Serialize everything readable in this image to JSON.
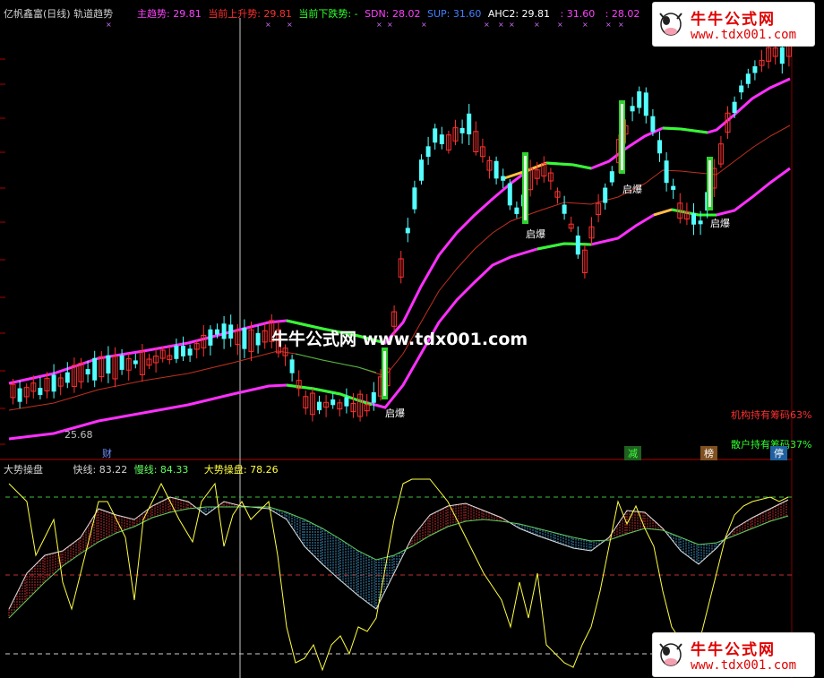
{
  "header": {
    "title": "亿帆鑫富(日线) 轨道趋势",
    "items": [
      {
        "label": "主趋势",
        "value": ": 29.81",
        "color": "#ff40ff"
      },
      {
        "label": "当前上升势",
        "value": ": 29.81",
        "color": "#ff3030"
      },
      {
        "label": "当前下跌势",
        "value": ": -",
        "color": "#30ff30"
      },
      {
        "label": "SDN",
        "value": ": 28.02",
        "color": "#ff40ff"
      },
      {
        "label": "SUP",
        "value": ": 31.60",
        "color": "#4080ff"
      },
      {
        "label": "AHC2",
        "value": ": 29.81",
        "color": "#ffffff"
      },
      {
        "label": "",
        "value": ": 31.60",
        "color": "#ff40ff"
      },
      {
        "label": "",
        "value": ": 28.02",
        "color": "#ff40ff"
      }
    ]
  },
  "main_chart": {
    "low_price_label": "25.68",
    "qibao_labels": [
      "启爆",
      "启爆",
      "启爆",
      "启爆"
    ],
    "watermark": "牛牛公式网 www.tdx001.com",
    "inst_chip": "机构持有筹码63%",
    "retail_chip": "散户持有筹码37%",
    "bottom_markers": [
      "财",
      "减",
      "榜",
      "停"
    ]
  },
  "sub_chart": {
    "title": "大势操盘",
    "fast_label": "快线",
    "fast_value": ": 83.22",
    "slow_label": "慢线",
    "slow_value": ": 84.33",
    "trend_label": "大势操盘",
    "trend_value": ": 78.26"
  },
  "badge": {
    "brand": "牛牛公式网",
    "url": "www.tdx001.com"
  },
  "colors": {
    "up": "#ff3030",
    "down": "#54ffff",
    "magenta": "#ff30ff",
    "green": "#30ff30",
    "yellow": "#ffff40",
    "bg": "#000000"
  }
}
